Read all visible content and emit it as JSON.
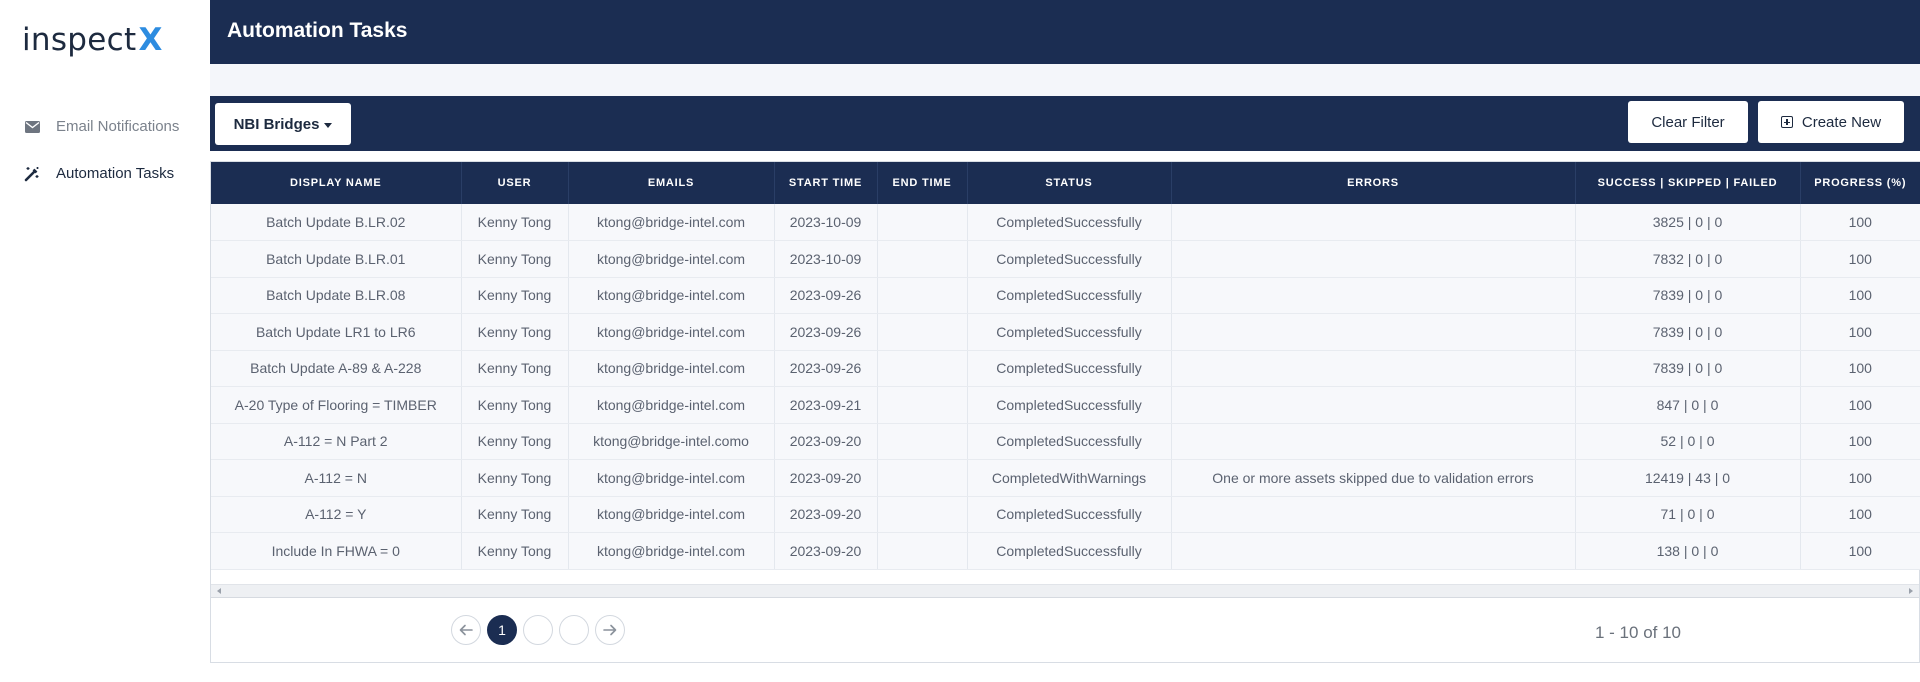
{
  "app": {
    "logo_text": "inspect",
    "logo_mark": "X"
  },
  "sidebar": {
    "items": [
      {
        "label": "Email Notifications",
        "icon": "envelope-icon",
        "active": false
      },
      {
        "label": "Automation Tasks",
        "icon": "magic-wand-icon",
        "active": true
      }
    ]
  },
  "header": {
    "title": "Automation Tasks"
  },
  "toolbar": {
    "filter_label": "NBI Bridges",
    "clear_label": "Clear Filter",
    "create_label": "Create New"
  },
  "table": {
    "columns": [
      "Display Name",
      "User",
      "Emails",
      "Start Time",
      "End Time",
      "Status",
      "Errors",
      "Success | Skipped | Failed",
      "Progress (%)"
    ],
    "rows": [
      [
        "Batch Update B.LR.02",
        "Kenny Tong",
        "ktong@bridge-intel.com",
        "2023-10-09",
        "",
        "CompletedSuccessfully",
        "",
        "3825 | 0 | 0",
        "100"
      ],
      [
        "Batch Update B.LR.01",
        "Kenny Tong",
        "ktong@bridge-intel.com",
        "2023-10-09",
        "",
        "CompletedSuccessfully",
        "",
        "7832 | 0 | 0",
        "100"
      ],
      [
        "Batch Update B.LR.08",
        "Kenny Tong",
        "ktong@bridge-intel.com",
        "2023-09-26",
        "",
        "CompletedSuccessfully",
        "",
        "7839 | 0 | 0",
        "100"
      ],
      [
        "Batch Update LR1 to LR6",
        "Kenny Tong",
        "ktong@bridge-intel.com",
        "2023-09-26",
        "",
        "CompletedSuccessfully",
        "",
        "7839 | 0 | 0",
        "100"
      ],
      [
        "Batch Update A-89 & A-228",
        "Kenny Tong",
        "ktong@bridge-intel.com",
        "2023-09-26",
        "",
        "CompletedSuccessfully",
        "",
        "7839 | 0 | 0",
        "100"
      ],
      [
        "A-20 Type of Flooring = TIMBER",
        "Kenny Tong",
        "ktong@bridge-intel.com",
        "2023-09-21",
        "",
        "CompletedSuccessfully",
        "",
        "847 | 0 | 0",
        "100"
      ],
      [
        "A-112 = N Part 2",
        "Kenny Tong",
        "ktong@bridge-intel.como",
        "2023-09-20",
        "",
        "CompletedSuccessfully",
        "",
        "52 | 0 | 0",
        "100"
      ],
      [
        "A-112 = N",
        "Kenny Tong",
        "ktong@bridge-intel.com",
        "2023-09-20",
        "",
        "CompletedWithWarnings",
        "One or more assets skipped due to validation errors",
        "12419 | 43 | 0",
        "100"
      ],
      [
        "A-112 = Y",
        "Kenny Tong",
        "ktong@bridge-intel.com",
        "2023-09-20",
        "",
        "CompletedSuccessfully",
        "",
        "71 | 0 | 0",
        "100"
      ],
      [
        "Include In FHWA = 0",
        "Kenny Tong",
        "ktong@bridge-intel.com",
        "2023-09-20",
        "",
        "CompletedSuccessfully",
        "",
        "138 | 0 | 0",
        "100"
      ]
    ]
  },
  "pagination": {
    "pages": [
      "1",
      "",
      ""
    ],
    "current": "1",
    "info": "1 - 10 of 10"
  },
  "colors": {
    "navy": "#1b2d52",
    "accent": "#2d8ce0"
  }
}
